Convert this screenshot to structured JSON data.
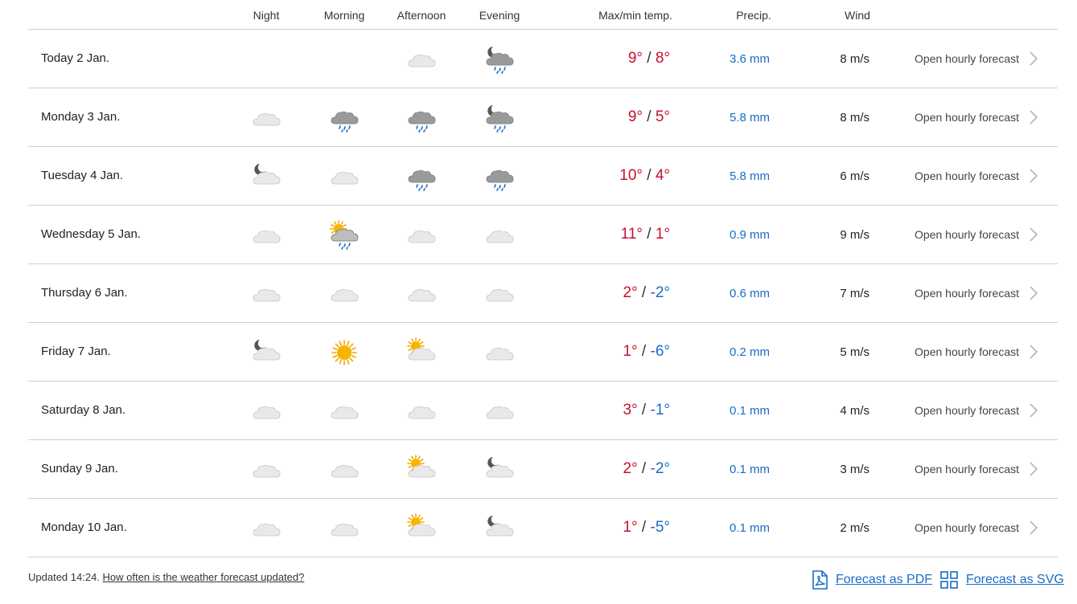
{
  "header": {
    "night": "Night",
    "morning": "Morning",
    "afternoon": "Afternoon",
    "evening": "Evening",
    "temp": "Max/min temp.",
    "precip": "Precip.",
    "wind": "Wind"
  },
  "days": [
    {
      "label": "Today 2 Jan.",
      "icons": [
        "",
        "",
        "cloudy",
        "night-rain"
      ],
      "max": "9°",
      "min": "8°",
      "min_negative": false,
      "precip": "3.6 mm",
      "wind": "8 m/s",
      "link": "Open hourly forecast"
    },
    {
      "label": "Monday 3 Jan.",
      "icons": [
        "cloudy",
        "rain",
        "rain",
        "night-rain"
      ],
      "max": "9°",
      "min": "5°",
      "min_negative": false,
      "precip": "5.8 mm",
      "wind": "8 m/s",
      "link": "Open hourly forecast"
    },
    {
      "label": "Tuesday 4 Jan.",
      "icons": [
        "night-cloudy",
        "cloudy",
        "rain",
        "rain"
      ],
      "max": "10°",
      "min": "4°",
      "min_negative": false,
      "precip": "5.8 mm",
      "wind": "6 m/s",
      "link": "Open hourly forecast"
    },
    {
      "label": "Wednesday 5 Jan.",
      "icons": [
        "cloudy",
        "sun-rain",
        "cloudy",
        "cloudy"
      ],
      "max": "11°",
      "min": "1°",
      "min_negative": false,
      "precip": "0.9 mm",
      "wind": "9 m/s",
      "link": "Open hourly forecast"
    },
    {
      "label": "Thursday 6 Jan.",
      "icons": [
        "cloudy",
        "cloudy",
        "cloudy",
        "cloudy"
      ],
      "max": "2°",
      "min": "-2°",
      "min_negative": true,
      "precip": "0.6 mm",
      "wind": "7 m/s",
      "link": "Open hourly forecast"
    },
    {
      "label": "Friday 7 Jan.",
      "icons": [
        "night-cloudy",
        "sun",
        "sun-cloudy",
        "cloudy"
      ],
      "max": "1°",
      "min": "-6°",
      "min_negative": true,
      "precip": "0.2 mm",
      "wind": "5 m/s",
      "link": "Open hourly forecast"
    },
    {
      "label": "Saturday 8 Jan.",
      "icons": [
        "cloudy",
        "cloudy",
        "cloudy",
        "cloudy"
      ],
      "max": "3°",
      "min": "-1°",
      "min_negative": true,
      "precip": "0.1 mm",
      "wind": "4 m/s",
      "link": "Open hourly forecast"
    },
    {
      "label": "Sunday 9 Jan.",
      "icons": [
        "cloudy",
        "cloudy",
        "sun-cloudy",
        "night-cloudy"
      ],
      "max": "2°",
      "min": "-2°",
      "min_negative": true,
      "precip": "0.1 mm",
      "wind": "3 m/s",
      "link": "Open hourly forecast"
    },
    {
      "label": "Monday 10 Jan.",
      "icons": [
        "cloudy",
        "cloudy",
        "sun-cloudy",
        "night-cloudy"
      ],
      "max": "1°",
      "min": "-5°",
      "min_negative": true,
      "precip": "0.1 mm",
      "wind": "2 m/s",
      "link": "Open hourly forecast"
    }
  ],
  "footer": {
    "updated": "Updated 14:24.",
    "how_often": "How often is the weather forecast updated?",
    "pdf": "Forecast as PDF",
    "svg": "Forecast as SVG"
  },
  "colors": {
    "max_temp": "#c8102e",
    "min_temp": "#1a6bc7",
    "precip": "#1a6bc7",
    "link": "#1a6bc7",
    "divider": "#cfcfcf"
  }
}
